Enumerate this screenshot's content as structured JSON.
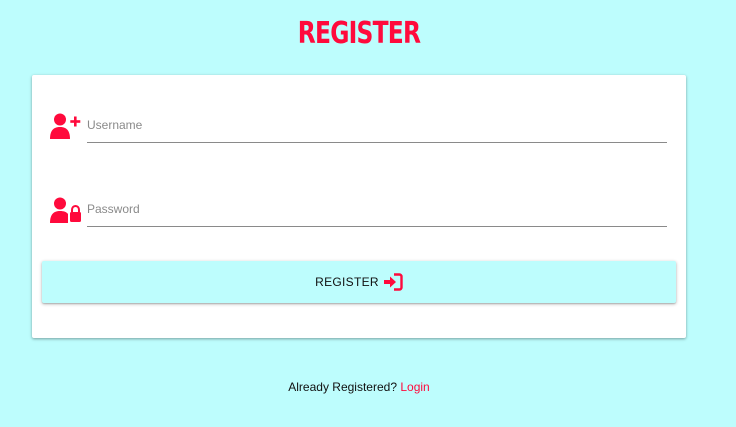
{
  "header": {
    "title": "REGISTER"
  },
  "form": {
    "username": {
      "placeholder": "Username",
      "value": "",
      "icon": "user-plus-icon"
    },
    "password": {
      "placeholder": "Password",
      "value": "",
      "icon": "user-lock-icon"
    },
    "submit": {
      "label": "REGISTER",
      "icon": "sign-in-icon"
    }
  },
  "footer": {
    "prompt": "Already Registered?",
    "link_label": "Login"
  },
  "colors": {
    "background": "#bdfdfd",
    "accent": "#ff0a3c",
    "card": "#ffffff"
  }
}
